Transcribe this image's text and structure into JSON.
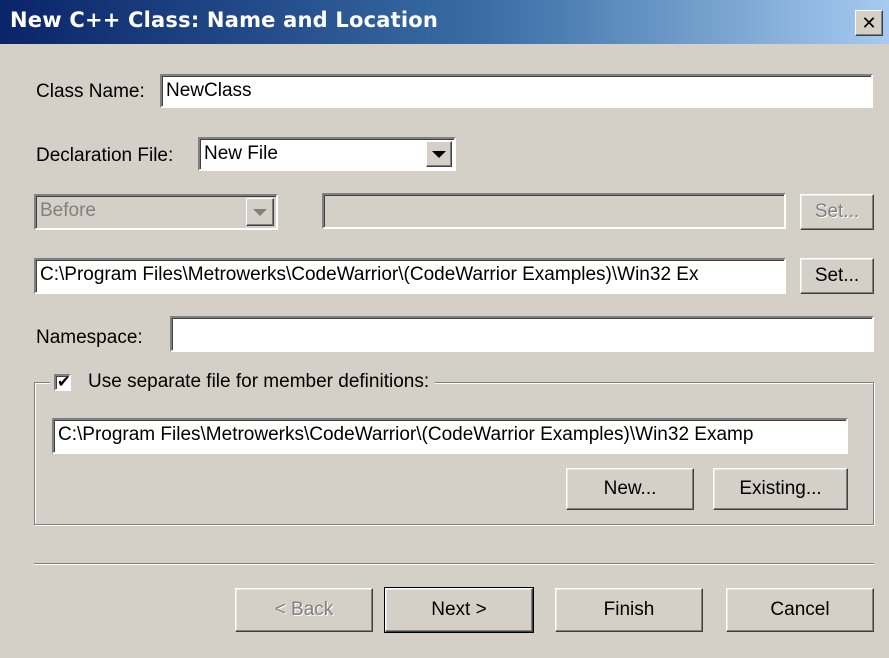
{
  "window": {
    "title": "New C++ Class: Name and Location",
    "close_label": "✕"
  },
  "class_name": {
    "label": "Class Name:",
    "value": "NewClass"
  },
  "declaration_file": {
    "label": "Declaration File:",
    "selected": "New File"
  },
  "position": {
    "selected": "Before",
    "value": "",
    "set_label": "Set..."
  },
  "decl_path": {
    "value": "C:\\Program Files\\Metrowerks\\CodeWarrior\\(CodeWarrior Examples)\\Win32 Ex",
    "set_label": "Set..."
  },
  "namespace": {
    "label": "Namespace:",
    "value": ""
  },
  "member_defs": {
    "checked": true,
    "check_glyph": "✔",
    "label": "Use separate file for member definitions:",
    "path": "C:\\Program Files\\Metrowerks\\CodeWarrior\\(CodeWarrior Examples)\\Win32 Examp",
    "new_label": "New...",
    "existing_label": "Existing..."
  },
  "footer": {
    "back_label": "< Back",
    "next_label": "Next >",
    "finish_label": "Finish",
    "cancel_label": "Cancel"
  }
}
